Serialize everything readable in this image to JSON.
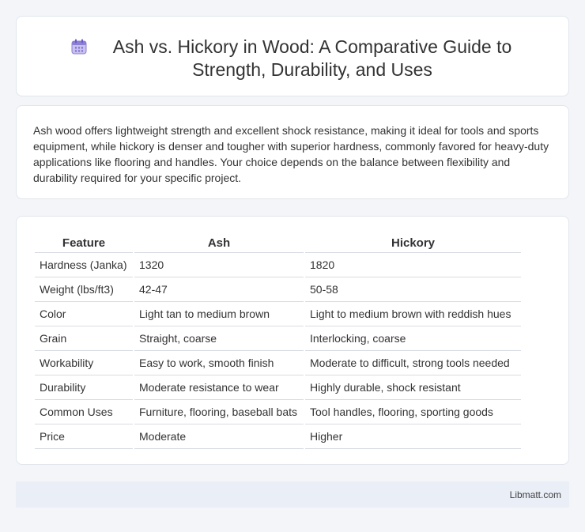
{
  "header": {
    "icon": "calendar-icon",
    "title": "Ash vs. Hickory in Wood: A Comparative Guide to Strength, Durability, and Uses"
  },
  "summary": {
    "text": "Ash wood offers lightweight strength and excellent shock resistance, making it ideal for tools and sports equipment, while hickory is denser and tougher with superior hardness, commonly favored for heavy-duty applications like flooring and handles. Your choice depends on the balance between flexibility and durability required for your specific project."
  },
  "table": {
    "headers": [
      "Feature",
      "Ash",
      "Hickory"
    ],
    "rows": [
      [
        "Hardness (Janka)",
        "1320",
        "1820"
      ],
      [
        "Weight (lbs/ft3)",
        "42-47",
        "50-58"
      ],
      [
        "Color",
        "Light tan to medium brown",
        "Light to medium brown with reddish hues"
      ],
      [
        "Grain",
        "Straight, coarse",
        "Interlocking, coarse"
      ],
      [
        "Workability",
        "Easy to work, smooth finish",
        "Moderate to difficult, strong tools needed"
      ],
      [
        "Durability",
        "Moderate resistance to wear",
        "Highly durable, shock resistant"
      ],
      [
        "Common Uses",
        "Furniture, flooring, baseball bats",
        "Tool handles, flooring, sporting goods"
      ],
      [
        "Price",
        "Moderate",
        "Higher"
      ]
    ]
  },
  "footer": {
    "text": "Libmatt.com"
  }
}
